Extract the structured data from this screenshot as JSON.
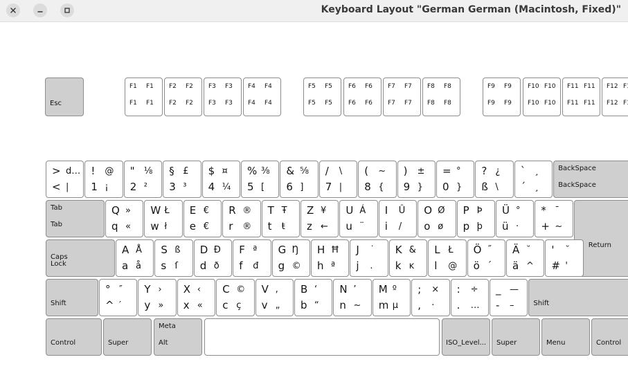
{
  "window": {
    "title": "Keyboard Layout \"German German (Macintosh, Fixed)\""
  },
  "keyboard": {
    "esc": "Esc",
    "fkeys": [
      "F1",
      "F2",
      "F3",
      "F4",
      "F5",
      "F6",
      "F7",
      "F8",
      "F9",
      "F10",
      "F11",
      "F12"
    ],
    "digits": [
      [
        ">",
        "d…",
        "<",
        "|"
      ],
      [
        "!",
        "@",
        "1",
        "¡"
      ],
      [
        "\"",
        "⅛",
        "2",
        "²"
      ],
      [
        "§",
        "£",
        "3",
        "³"
      ],
      [
        "$",
        "¤",
        "4",
        "¼"
      ],
      [
        "%",
        "⅜",
        "5",
        "["
      ],
      [
        "&",
        "⅝",
        "6",
        "]"
      ],
      [
        "/",
        "\\",
        "7",
        "|"
      ],
      [
        "(",
        "~",
        "8",
        "{"
      ],
      [
        ")",
        "±",
        "9",
        "}"
      ],
      [
        "=",
        "°",
        "0",
        "}"
      ],
      [
        "?",
        "¿",
        "ß",
        "\\"
      ],
      [
        "`",
        "¸",
        "´",
        "¸"
      ]
    ],
    "row_q": [
      [
        "Q",
        "»",
        "q",
        "«"
      ],
      [
        "W",
        "Ł",
        "w",
        "ł"
      ],
      [
        "E",
        "€",
        "e",
        "€"
      ],
      [
        "R",
        "®",
        "r",
        "®"
      ],
      [
        "T",
        "Ŧ",
        "t",
        "ŧ"
      ],
      [
        "Z",
        "¥",
        "z",
        "←"
      ],
      [
        "U",
        "Á",
        "u",
        "¨"
      ],
      [
        "I",
        "Û",
        "i",
        "/"
      ],
      [
        "O",
        "Ø",
        "o",
        "ø"
      ],
      [
        "P",
        "Þ",
        "p",
        "þ"
      ],
      [
        "Ü",
        "°",
        "ü",
        "·"
      ],
      [
        "*",
        "¯",
        "+",
        "~"
      ]
    ],
    "row_a": [
      [
        "A",
        "Å",
        "a",
        "å"
      ],
      [
        "S",
        "ß",
        "s",
        "ſ"
      ],
      [
        "D",
        "Ð",
        "d",
        "ð"
      ],
      [
        "F",
        "ª",
        "f",
        "đ"
      ],
      [
        "G",
        "Ŋ",
        "g",
        "©"
      ],
      [
        "H",
        "Ħ",
        "h",
        "ª"
      ],
      [
        "J",
        "˙",
        "j",
        "."
      ],
      [
        "K",
        "&",
        "k",
        "ĸ"
      ],
      [
        "L",
        "Ł",
        "l",
        "@"
      ],
      [
        "Ö",
        "˝",
        "ö",
        "´"
      ],
      [
        "Ä",
        "˘",
        "ä",
        "^"
      ],
      [
        "'",
        "˘",
        "#",
        "'"
      ]
    ],
    "row_y": [
      [
        "°",
        "″",
        "^",
        "′"
      ],
      [
        "Y",
        "›",
        "y",
        "»"
      ],
      [
        "X",
        "‹",
        "x",
        "«"
      ],
      [
        "C",
        "©",
        "c",
        "ç"
      ],
      [
        "V",
        ",",
        "v",
        "„"
      ],
      [
        "B",
        "‘",
        "b",
        "“"
      ],
      [
        "N",
        "’",
        "n",
        "~"
      ],
      [
        "M",
        "º",
        "m",
        "µ"
      ],
      [
        ";",
        "×",
        ",",
        "·"
      ],
      [
        ":",
        "÷",
        ".",
        "…"
      ],
      [
        "_",
        "—",
        "-",
        "–"
      ]
    ],
    "labels": {
      "tab": "Tab",
      "backspace": "BackSpace",
      "caps1": "Caps",
      "caps2": "Lock",
      "return": "Return",
      "shift": "Shift",
      "control": "Control",
      "super": "Super",
      "meta": "Meta",
      "alt": "Alt",
      "iso": "ISO_Level...",
      "menu": "Menu"
    }
  }
}
